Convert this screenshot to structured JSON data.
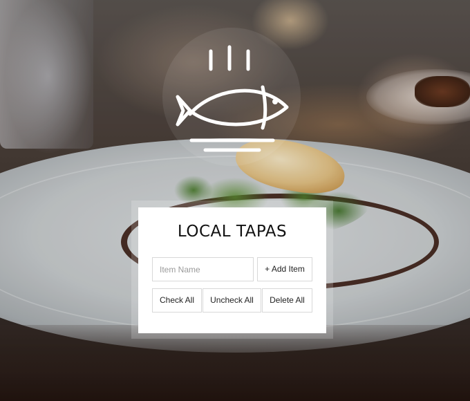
{
  "app": {
    "title": "LOCAL TAPAS"
  },
  "logo": {
    "icon": "fish-on-plate-icon"
  },
  "form": {
    "item_name_placeholder": "Item Name",
    "item_name_value": "",
    "add_label": "+ Add Item"
  },
  "actions": {
    "check_all_label": "Check All",
    "uncheck_all_label": "Uncheck All",
    "delete_all_label": "Delete All"
  },
  "colors": {
    "card_background": "#ffffff",
    "button_border": "#d8d8d8",
    "title_text": "#111111"
  }
}
